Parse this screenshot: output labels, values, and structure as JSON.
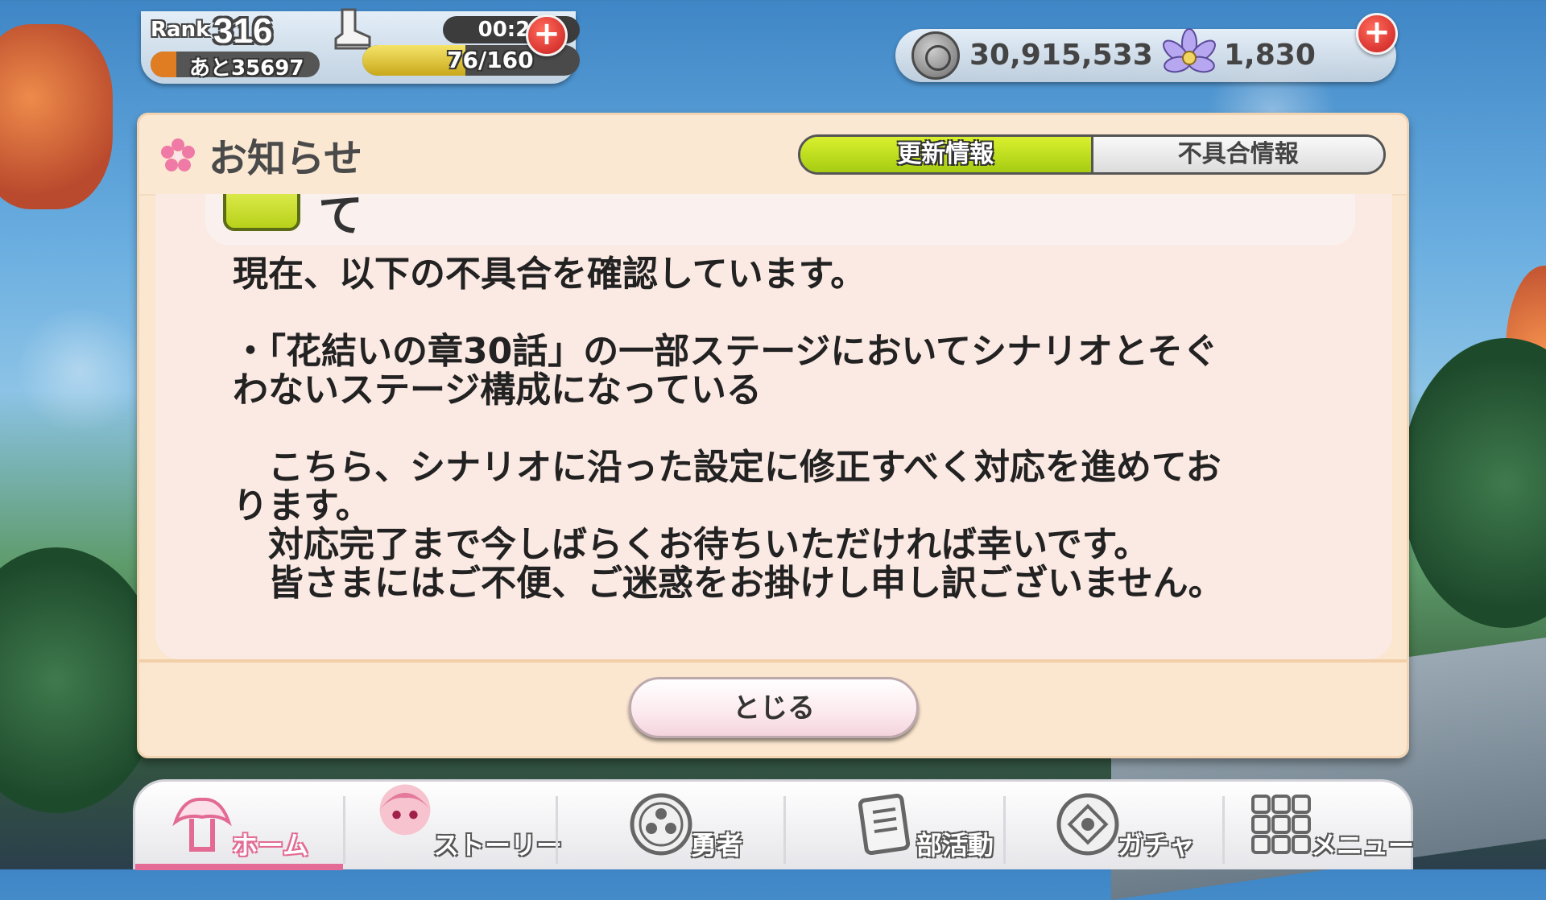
{
  "hud": {
    "rank_label": "Rank",
    "rank_value": "316",
    "rank_remaining": "あと35697",
    "rank_progress": 0.15,
    "stamina_timer": "00:26",
    "stamina_value": "76/160",
    "stamina_progress": 0.475,
    "coins": "30,915,533",
    "gems": "1,830"
  },
  "dialog": {
    "title": "お知らせ",
    "tabs": [
      {
        "label": "更新情報",
        "active": true
      },
      {
        "label": "不具合情報",
        "active": false
      }
    ],
    "previous_item_text": "て",
    "body": {
      "line1": "現在、以下の不具合を確認しています。",
      "line2": "・「花結いの章30話」の一部ステージにおいてシナリオとそぐ\nわないステージ構成になっている",
      "line3": "　こちら、シナリオに沿った設定に修正すべく対応を進めてお\nります。\n　対応完了まで今しばらくお待ちいただければ幸いです。\n　皆さまにはご不便、ご迷惑をお掛けし申し訳ございません。"
    },
    "close_label": "とじる"
  },
  "nav": {
    "items": [
      {
        "label": "ホーム",
        "icon": "home-icon",
        "active": true
      },
      {
        "label": "ストーリー",
        "icon": "story-character-icon",
        "active": false
      },
      {
        "label": "勇者",
        "icon": "hero-crest-icon",
        "active": false
      },
      {
        "label": "部活動",
        "icon": "club-activity-icon",
        "active": false
      },
      {
        "label": "ガチャ",
        "icon": "gacha-crest-icon",
        "active": false
      },
      {
        "label": "メニュー",
        "icon": "menu-grid-icon",
        "active": false
      }
    ]
  },
  "colors": {
    "accent_green": "#b8d11a",
    "nav_active_pink": "#e46b96",
    "dialog_bg": "#fbe6cf",
    "plus_red": "#c81e1e"
  }
}
